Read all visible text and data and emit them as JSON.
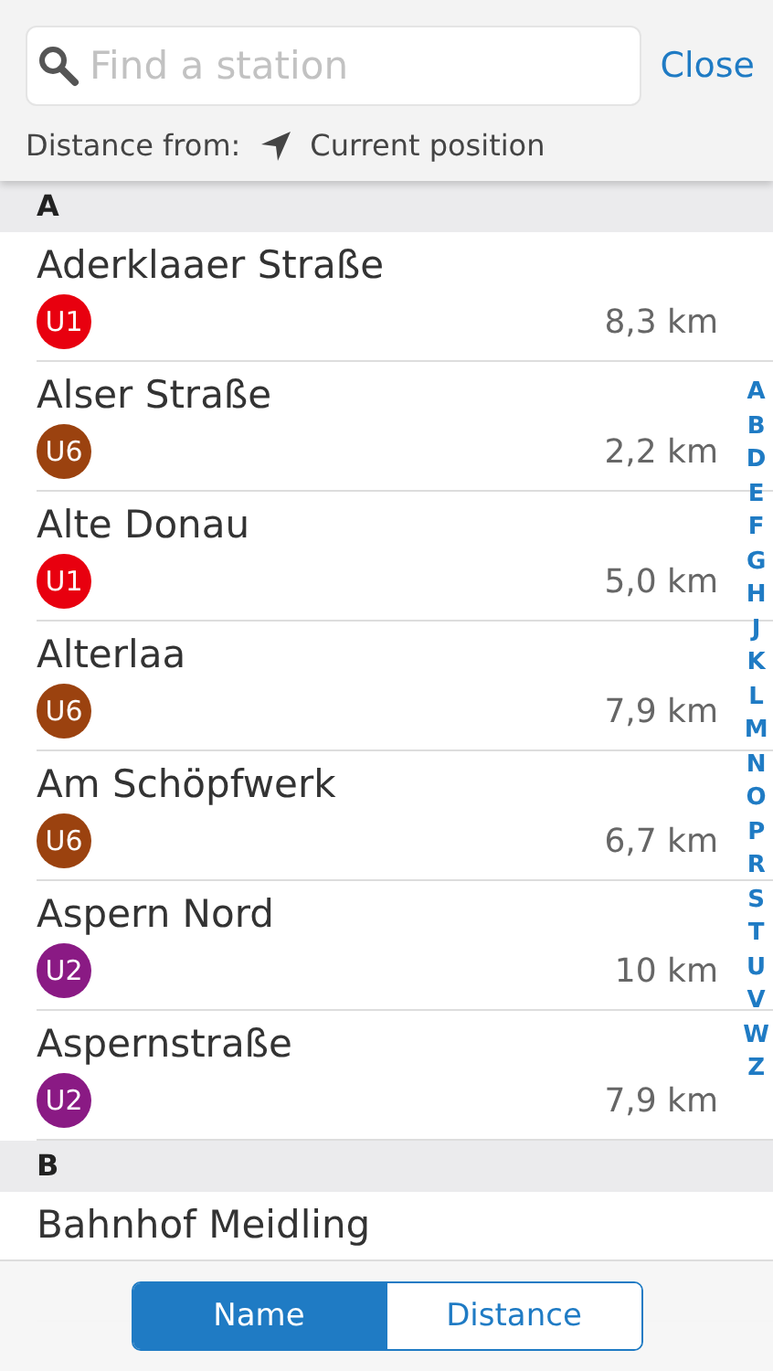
{
  "search": {
    "placeholder": "Find a station",
    "close": "Close"
  },
  "distance_from": {
    "label": "Distance from:",
    "value": "Current position"
  },
  "sections": [
    {
      "letter": "A",
      "stations": [
        {
          "name": "Aderklaaer Straße",
          "line": "U1",
          "color": "#e8000f",
          "distance": "8,3 km"
        },
        {
          "name": "Alser Straße",
          "line": "U6",
          "color": "#9b420f",
          "distance": "2,2 km"
        },
        {
          "name": "Alte Donau",
          "line": "U1",
          "color": "#e8000f",
          "distance": "5,0 km"
        },
        {
          "name": "Alterlaa",
          "line": "U6",
          "color": "#9b420f",
          "distance": "7,9 km"
        },
        {
          "name": "Am Schöpfwerk",
          "line": "U6",
          "color": "#9b420f",
          "distance": "6,7 km"
        },
        {
          "name": "Aspern Nord",
          "line": "U2",
          "color": "#8a1a84",
          "distance": "10 km"
        },
        {
          "name": "Aspernstraße",
          "line": "U2",
          "color": "#8a1a84",
          "distance": "7,9 km"
        }
      ]
    },
    {
      "letter": "B",
      "stations": [
        {
          "name": "Bahnhof Meidling"
        }
      ]
    }
  ],
  "index": [
    "A",
    "B",
    "D",
    "E",
    "F",
    "G",
    "H",
    "J",
    "K",
    "L",
    "M",
    "N",
    "O",
    "P",
    "R",
    "S",
    "T",
    "U",
    "V",
    "W",
    "Z"
  ],
  "sort": [
    {
      "label": "Name",
      "selected": true
    },
    {
      "label": "Distance",
      "selected": false
    }
  ]
}
